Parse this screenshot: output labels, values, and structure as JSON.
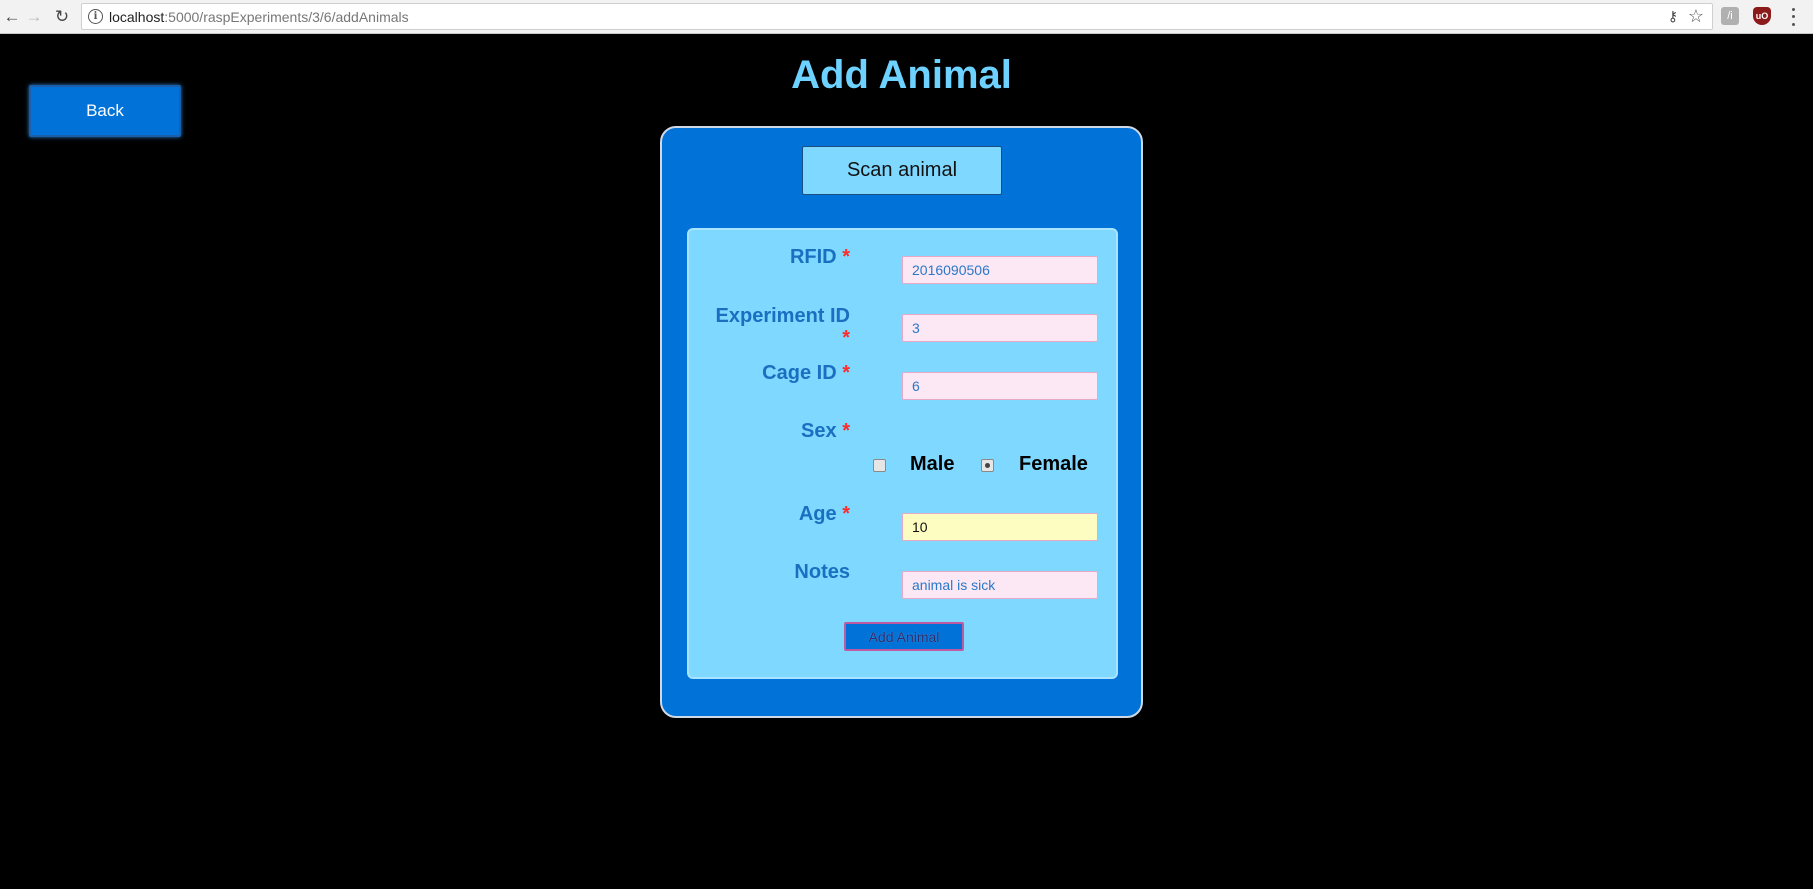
{
  "browser": {
    "back_icon": "←",
    "forward_icon": "→",
    "reload_icon": "↻",
    "info_icon": "i",
    "url_host": "localhost",
    "url_rest": ":5000/raspExperiments/3/6/addAnimals",
    "key_icon": "⚷",
    "star_icon": "☆",
    "ext1_glyph": "/i",
    "ext2_glyph": "uO"
  },
  "page": {
    "back_label": "Back",
    "title": "Add Animal",
    "scan_label": "Scan animal"
  },
  "form": {
    "rfid_label": "RFID",
    "rfid_value": "2016090506",
    "experiment_label_1": "Experiment ID",
    "experiment_value": "3",
    "cage_label": "Cage ID",
    "cage_value": "6",
    "sex_label": "Sex",
    "male_label": "Male",
    "female_label": "Female",
    "sex_selected": "Female",
    "age_label": "Age",
    "age_value": "10",
    "notes_label": "Notes",
    "notes_value": "animal is sick",
    "required_mark": "*",
    "submit_label": "Add Animal"
  },
  "colors": {
    "background": "#000000",
    "title": "#6dd2ff",
    "card": "#0172d8",
    "panel": "#7fd8ff",
    "label": "#1a6fc0",
    "required": "#ff2a2a"
  }
}
